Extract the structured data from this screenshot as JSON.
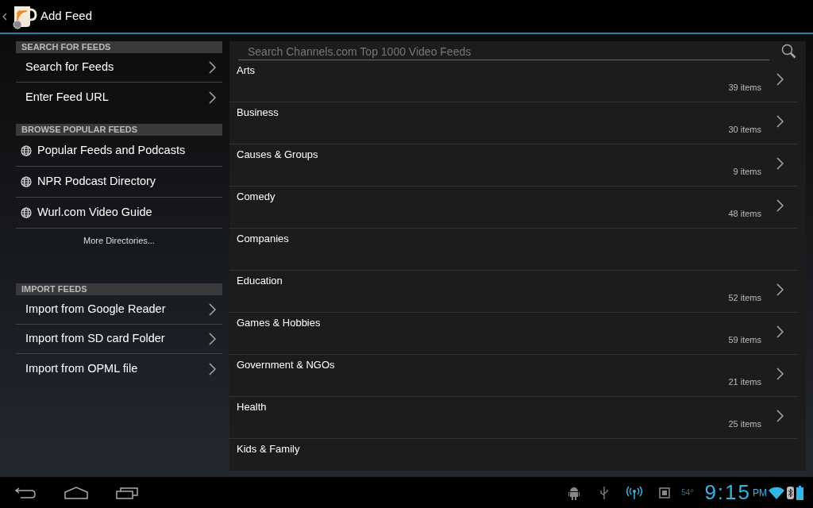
{
  "action_bar": {
    "title": "Add Feed"
  },
  "sidebar": {
    "sections": [
      {
        "header": "SEARCH FOR FEEDS",
        "items": [
          {
            "kind": "chevron",
            "label": "Search for Feeds"
          },
          {
            "kind": "chevron",
            "label": "Enter Feed URL"
          }
        ]
      },
      {
        "header": "BROWSE POPULAR FEEDS",
        "items": [
          {
            "kind": "globe",
            "label": "Popular Feeds and Podcasts"
          },
          {
            "kind": "globe",
            "label": "NPR Podcast Directory"
          },
          {
            "kind": "globe",
            "label": "Wurl.com Video Guide"
          },
          {
            "kind": "more",
            "label": "More Directories..."
          }
        ]
      },
      {
        "header": "IMPORT FEEDS",
        "items": [
          {
            "kind": "chevron",
            "label": "Import from Google Reader"
          },
          {
            "kind": "chevron",
            "label": "Import from SD card Folder"
          },
          {
            "kind": "chevron",
            "label": "Import from OPML file"
          }
        ]
      }
    ]
  },
  "search": {
    "placeholder": "Search Channels.com Top 1000 Video Feeds"
  },
  "categories": [
    {
      "name": "Arts",
      "count": "39 items"
    },
    {
      "name": "Business",
      "count": "30 items"
    },
    {
      "name": "Causes & Groups",
      "count": "9 items"
    },
    {
      "name": "Comedy",
      "count": "48 items"
    },
    {
      "name": "Companies"
    },
    {
      "name": "Education",
      "count": "52 items"
    },
    {
      "name": "Games & Hobbies",
      "count": "59 items"
    },
    {
      "name": "Government & NGOs",
      "count": "21 items"
    },
    {
      "name": "Health",
      "count": "25 items"
    },
    {
      "name": "Kids & Family"
    }
  ],
  "status_bar": {
    "temperature": "54°",
    "time": "9:15",
    "ampm": "PM"
  }
}
